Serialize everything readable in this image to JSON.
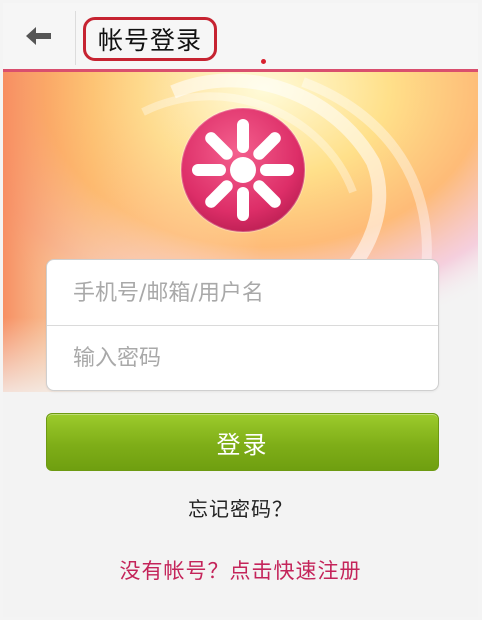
{
  "header": {
    "title": "帐号登录",
    "back_icon": "arrow-left-icon"
  },
  "logo": {
    "icon": "asterisk-flower-icon",
    "color": "#e0336b"
  },
  "form": {
    "username_placeholder": "手机号/邮箱/用户名",
    "password_placeholder": "输入密码",
    "login_label": "登录",
    "forgot_label": "忘记密码？",
    "register_label": "没有帐号？点击快速注册"
  },
  "colors": {
    "accent": "#d94f6e",
    "button": "#7fae18",
    "link": "#c4245a"
  }
}
